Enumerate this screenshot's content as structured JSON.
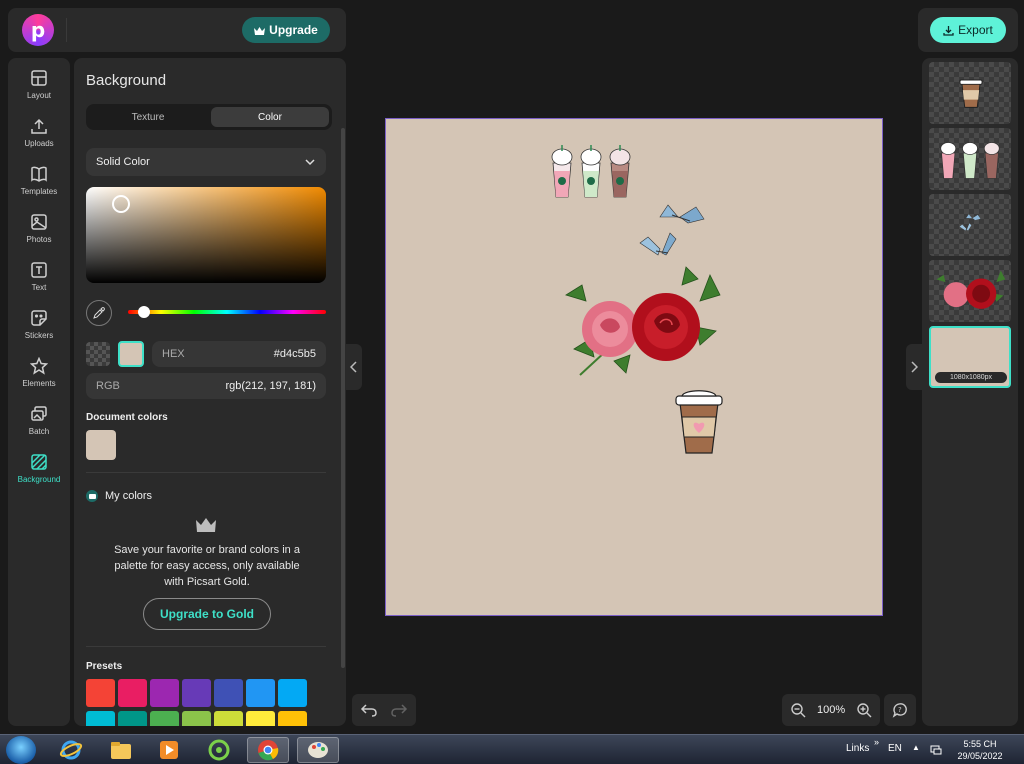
{
  "header": {
    "logo_letter": "p",
    "upgrade_label": "Upgrade",
    "export_label": "Export"
  },
  "rail": {
    "items": [
      {
        "label": "Layout",
        "icon": "layout-icon"
      },
      {
        "label": "Uploads",
        "icon": "upload-icon"
      },
      {
        "label": "Templates",
        "icon": "book-icon"
      },
      {
        "label": "Photos",
        "icon": "image-icon"
      },
      {
        "label": "Text",
        "icon": "text-icon"
      },
      {
        "label": "Stickers",
        "icon": "sticker-icon"
      },
      {
        "label": "Elements",
        "icon": "star-icon"
      },
      {
        "label": "Batch",
        "icon": "batch-icon"
      },
      {
        "label": "Background",
        "icon": "background-icon",
        "active": true
      }
    ]
  },
  "panel": {
    "title": "Background",
    "tabs": [
      "Texture",
      "Color"
    ],
    "active_tab": "Color",
    "fill_type": "Solid Color",
    "hex_label": "HEX",
    "hex_value": "#d4c5b5",
    "rgb_label": "RGB",
    "rgb_value": "rgb(212, 197, 181)",
    "document_colors_label": "Document colors",
    "document_colors": [
      "#d4c5b5"
    ],
    "my_colors_label": "My colors",
    "save_message": "Save your favorite or brand colors in a palette for easy access, only available with Picsart Gold.",
    "gold_button": "Upgrade to Gold",
    "presets_label": "Presets",
    "presets_row1": [
      "#f44336",
      "#e91e63",
      "#9c27b0",
      "#673ab7",
      "#3f51b5",
      "#2196f3",
      "#03a9f4"
    ],
    "presets_row2": [
      "#00bcd4",
      "#009688",
      "#4caf50",
      "#8bc34a",
      "#cddc39",
      "#ffeb3b",
      "#ffc107"
    ]
  },
  "canvas": {
    "background": "#d4c5b5"
  },
  "zoom": {
    "value": "100%"
  },
  "layers": {
    "selected_size": "1080x1080px"
  },
  "colors": {
    "accent": "#3ee0c8",
    "upgrade_bg": "#1d6b66",
    "export_bg": "#5ef2d8"
  },
  "taskbar": {
    "links": "Links",
    "lang": "EN",
    "time": "5:55 CH",
    "date": "29/05/2022"
  }
}
